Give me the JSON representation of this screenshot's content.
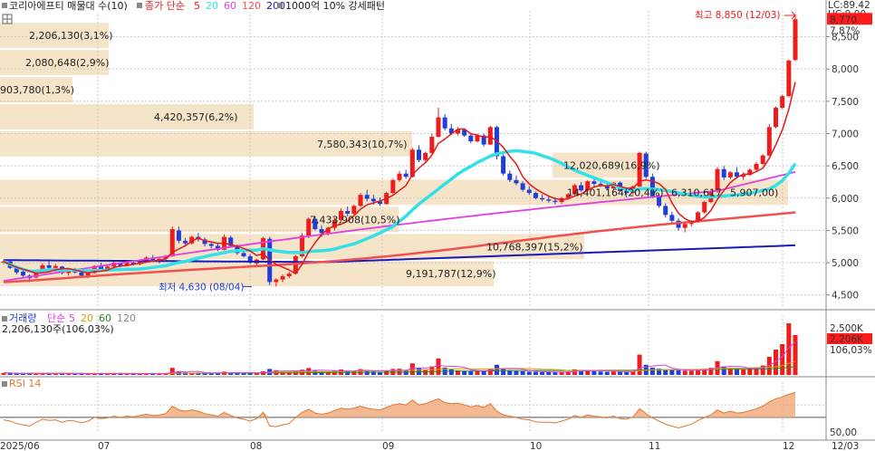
{
  "header": {
    "title": "코리아에프티 매물대 수(10)",
    "ma_prefix": "종가 단순",
    "ma_periods": [
      "5",
      "20",
      "60",
      "120",
      "200"
    ],
    "volume_rule": "1000억 10% 강세패턴"
  },
  "top_right": {
    "lc": "LC:89.42",
    "hc": "HC:9.00"
  },
  "colors": {
    "up": "#ee1c1c",
    "down": "#1f3fd8",
    "ma5": "#e41a1a",
    "ma20": "#33e0e8",
    "ma60": "#e040e0",
    "ma120": "#f05050",
    "ma200": "#1a1ab8",
    "band": "#f5e4c8",
    "grid": "#c8c8c8",
    "price_box": "#ff1a1a",
    "rsi_fill": "#f0a878",
    "rsi_line": "#e07830"
  },
  "volume_panel": {
    "title": "거래량",
    "ma_prefix": "단순",
    "ma_periods": [
      "5",
      "20",
      "60",
      "120"
    ],
    "current_text": "2,206,130주(106,03%)",
    "current_value_label": "2,206K",
    "current_ratio_label": "106,03%",
    "axis_label": "2,500K"
  },
  "rsi_panel": {
    "title": "RSI 14",
    "level_label": "50,00"
  },
  "chart_data": {
    "type": "candlestick",
    "price_axis": {
      "ticks": [
        "4,500",
        "5,000",
        "5,500",
        "6,000",
        "6,500",
        "7,000",
        "7,500",
        "8,000",
        "8,500"
      ],
      "ylim": [
        4300,
        8900
      ]
    },
    "x_labels": [
      "2025/06",
      "07",
      "08",
      "09",
      "10",
      "11",
      "12",
      "12/03"
    ],
    "current_price_label": "8,770",
    "current_change_label": "7,87%",
    "high_label": "최고 8,850 (12/03)",
    "low_label": "최저 4,630 (08/04)",
    "volume_profile": [
      {
        "label": "2,206,130(3,1%)",
        "price": 8520
      },
      {
        "label": "2,080,648(2,9%)",
        "price": 8100
      },
      {
        "label": "903,780(1,3%)",
        "price": 7680
      },
      {
        "label": "4,420,357(6,2%)",
        "price": 7260
      },
      {
        "label": "7,580,343(10,7%)",
        "price": 6840
      },
      {
        "label": "12,020,689(16,9%)",
        "price": 6510
      },
      {
        "label": "14,401,164(20,4%)",
        "price": 6090
      },
      {
        "label": "6,310,617",
        "price": 6090
      },
      {
        "label": "5,907,00)",
        "price": 6090
      },
      {
        "label": "7,433,908(10,5%)",
        "price": 5670
      },
      {
        "label": "10,768,397(15,2%)",
        "price": 5250
      },
      {
        "label": "9,191,787(12,9%)",
        "price": 4830
      }
    ],
    "candles": [
      [
        5000,
        5050,
        4980,
        5020
      ],
      [
        5020,
        5030,
        4900,
        4920
      ],
      [
        4930,
        4960,
        4820,
        4850
      ],
      [
        4860,
        4900,
        4780,
        4800
      ],
      [
        4800,
        4820,
        4700,
        4760
      ],
      [
        4770,
        4880,
        4760,
        4860
      ],
      [
        4860,
        4990,
        4840,
        4960
      ],
      [
        4960,
        5020,
        4900,
        4920
      ],
      [
        4920,
        4980,
        4860,
        4950
      ],
      [
        4940,
        4950,
        4820,
        4840
      ],
      [
        4840,
        4900,
        4800,
        4880
      ],
      [
        4880,
        4920,
        4830,
        4850
      ],
      [
        4850,
        4880,
        4780,
        4800
      ],
      [
        4800,
        4860,
        4760,
        4840
      ],
      [
        4840,
        4960,
        4830,
        4950
      ],
      [
        4950,
        5000,
        4880,
        4900
      ],
      [
        4900,
        4960,
        4860,
        4940
      ],
      [
        4940,
        5020,
        4920,
        5000
      ],
      [
        4990,
        5010,
        4930,
        4950
      ],
      [
        4950,
        5010,
        4940,
        5000
      ],
      [
        5000,
        5040,
        4960,
        4980
      ],
      [
        4980,
        5040,
        4960,
        5030
      ],
      [
        5030,
        5100,
        5000,
        5080
      ],
      [
        5080,
        5120,
        5020,
        5040
      ],
      [
        5040,
        5080,
        4990,
        5060
      ],
      [
        5060,
        5120,
        5030,
        5100
      ],
      [
        5100,
        5560,
        5090,
        5520
      ],
      [
        5500,
        5560,
        5300,
        5340
      ],
      [
        5340,
        5380,
        5250,
        5300
      ],
      [
        5300,
        5420,
        5280,
        5400
      ],
      [
        5400,
        5460,
        5330,
        5360
      ],
      [
        5360,
        5390,
        5250,
        5290
      ],
      [
        5290,
        5330,
        5220,
        5260
      ],
      [
        5260,
        5300,
        5180,
        5200
      ],
      [
        5200,
        5440,
        5190,
        5400
      ],
      [
        5390,
        5420,
        5240,
        5260
      ],
      [
        5250,
        5280,
        5120,
        5150
      ],
      [
        5150,
        5200,
        5080,
        5100
      ],
      [
        5100,
        5130,
        4980,
        5000
      ],
      [
        4990,
        5060,
        4930,
        5050
      ],
      [
        5050,
        5400,
        5040,
        5380
      ],
      [
        5370,
        5400,
        4650,
        4700
      ],
      [
        4700,
        4760,
        4630,
        4740
      ],
      [
        4740,
        4820,
        4700,
        4790
      ],
      [
        4790,
        4860,
        4760,
        4830
      ],
      [
        4830,
        5120,
        4820,
        5100
      ],
      [
        5100,
        5460,
        5080,
        5420
      ],
      [
        5420,
        5700,
        5380,
        5680
      ],
      [
        5680,
        5720,
        5500,
        5520
      ],
      [
        5520,
        5580,
        5400,
        5460
      ],
      [
        5460,
        5560,
        5420,
        5540
      ],
      [
        5540,
        5700,
        5500,
        5660
      ],
      [
        5660,
        5840,
        5620,
        5800
      ],
      [
        5800,
        5870,
        5720,
        5760
      ],
      [
        5760,
        5900,
        5740,
        5880
      ],
      [
        5880,
        6080,
        5860,
        6050
      ],
      [
        6050,
        6130,
        5950,
        5990
      ],
      [
        5990,
        6050,
        5900,
        5950
      ],
      [
        5950,
        6010,
        5880,
        5910
      ],
      [
        5910,
        6100,
        5900,
        6080
      ],
      [
        6080,
        6300,
        6060,
        6280
      ],
      [
        6280,
        6420,
        6250,
        6380
      ],
      [
        6380,
        6440,
        6300,
        6330
      ],
      [
        6330,
        6780,
        6320,
        6750
      ],
      [
        6750,
        6820,
        6560,
        6590
      ],
      [
        6590,
        6720,
        6570,
        6700
      ],
      [
        6700,
        7000,
        6680,
        6950
      ],
      [
        6950,
        7400,
        6940,
        7250
      ],
      [
        7250,
        7300,
        7050,
        7080
      ],
      [
        7080,
        7150,
        6980,
        7000
      ],
      [
        7000,
        7100,
        6970,
        7060
      ],
      [
        7060,
        7080,
        6950,
        6970
      ],
      [
        6970,
        7000,
        6850,
        6880
      ],
      [
        6880,
        7000,
        6860,
        6970
      ],
      [
        6970,
        7000,
        6800,
        6830
      ],
      [
        6830,
        7120,
        6820,
        7100
      ],
      [
        7100,
        7120,
        6600,
        6650
      ],
      [
        6650,
        6680,
        6350,
        6380
      ],
      [
        6380,
        6430,
        6250,
        6280
      ],
      [
        6280,
        6350,
        6200,
        6230
      ],
      [
        6230,
        6260,
        6100,
        6130
      ],
      [
        6130,
        6180,
        6050,
        6080
      ],
      [
        6080,
        6100,
        5980,
        6000
      ],
      [
        6000,
        6060,
        5950,
        5980
      ],
      [
        5980,
        6040,
        5930,
        5960
      ],
      [
        5960,
        6010,
        5900,
        5940
      ],
      [
        5940,
        6020,
        5910,
        6000
      ],
      [
        6000,
        6080,
        5980,
        6060
      ],
      [
        6060,
        6220,
        6050,
        6200
      ],
      [
        6200,
        6250,
        6100,
        6120
      ],
      [
        6120,
        6280,
        6100,
        6260
      ],
      [
        6260,
        6320,
        6180,
        6220
      ],
      [
        6220,
        6300,
        6170,
        6190
      ],
      [
        6190,
        6260,
        6120,
        6150
      ],
      [
        6150,
        6250,
        6130,
        6240
      ],
      [
        6240,
        6260,
        6100,
        6110
      ],
      [
        6110,
        6150,
        6050,
        6080
      ],
      [
        6080,
        6200,
        6060,
        6180
      ],
      [
        6180,
        6720,
        6170,
        6700
      ],
      [
        6690,
        6720,
        6300,
        6330
      ],
      [
        6330,
        6380,
        6000,
        6030
      ],
      [
        6030,
        6070,
        5850,
        5880
      ],
      [
        5880,
        5920,
        5700,
        5740
      ],
      [
        5740,
        5790,
        5620,
        5650
      ],
      [
        5650,
        5690,
        5500,
        5540
      ],
      [
        5540,
        5620,
        5470,
        5600
      ],
      [
        5600,
        5660,
        5560,
        5640
      ],
      [
        5640,
        5800,
        5620,
        5780
      ],
      [
        5780,
        5960,
        5760,
        5940
      ],
      [
        5940,
        6120,
        5920,
        6100
      ],
      [
        6100,
        6480,
        6080,
        6450
      ],
      [
        6450,
        6500,
        6280,
        6320
      ],
      [
        6320,
        6420,
        6290,
        6400
      ],
      [
        6400,
        6480,
        6300,
        6330
      ],
      [
        6330,
        6400,
        6280,
        6360
      ],
      [
        6360,
        6460,
        6340,
        6440
      ],
      [
        6440,
        6560,
        6420,
        6530
      ],
      [
        6530,
        6680,
        6510,
        6660
      ],
      [
        6660,
        7150,
        6650,
        7100
      ],
      [
        7100,
        7420,
        7080,
        7400
      ],
      [
        7400,
        7600,
        7380,
        7580
      ],
      [
        7580,
        8150,
        7560,
        8130
      ],
      [
        8140,
        8850,
        8120,
        8770
      ]
    ],
    "volumes": [
      110,
      95,
      80,
      70,
      95,
      90,
      100,
      85,
      80,
      75,
      70,
      65,
      60,
      70,
      90,
      80,
      75,
      85,
      70,
      65,
      60,
      70,
      80,
      75,
      70,
      85,
      390,
      210,
      140,
      120,
      110,
      100,
      95,
      90,
      180,
      140,
      110,
      100,
      95,
      110,
      200,
      330,
      260,
      180,
      140,
      220,
      290,
      380,
      240,
      180,
      160,
      220,
      300,
      220,
      200,
      320,
      240,
      190,
      170,
      240,
      330,
      340,
      250,
      640,
      380,
      300,
      470,
      910,
      400,
      300,
      250,
      230,
      210,
      250,
      220,
      330,
      560,
      320,
      260,
      220,
      200,
      180,
      170,
      160,
      150,
      150,
      170,
      190,
      310,
      220,
      260,
      210,
      190,
      170,
      200,
      180,
      160,
      200,
      1120,
      560,
      400,
      340,
      300,
      280,
      260,
      240,
      230,
      290,
      340,
      390,
      760,
      470,
      380,
      340,
      300,
      360,
      420,
      520,
      1000,
      1400,
      1700,
      2850,
      2206
    ],
    "rsi": [
      46,
      44,
      40,
      38,
      36,
      42,
      47,
      45,
      46,
      42,
      45,
      44,
      41,
      44,
      50,
      48,
      49,
      52,
      50,
      52,
      51,
      53,
      55,
      53,
      54,
      56,
      68,
      62,
      60,
      62,
      60,
      56,
      54,
      52,
      58,
      53,
      49,
      47,
      44,
      48,
      58,
      36,
      35,
      38,
      40,
      50,
      58,
      63,
      57,
      55,
      57,
      61,
      65,
      63,
      65,
      68,
      65,
      63,
      62,
      66,
      70,
      72,
      70,
      78,
      70,
      72,
      76,
      80,
      74,
      72,
      73,
      70,
      67,
      69,
      66,
      72,
      60,
      54,
      52,
      50,
      47,
      46,
      43,
      42,
      42,
      41,
      44,
      47,
      53,
      50,
      54,
      52,
      51,
      49,
      52,
      48,
      47,
      51,
      64,
      56,
      49,
      44,
      39,
      36,
      33,
      36,
      39,
      45,
      50,
      54,
      62,
      57,
      60,
      57,
      58,
      61,
      64,
      68,
      75,
      80,
      83,
      87,
      90
    ]
  }
}
